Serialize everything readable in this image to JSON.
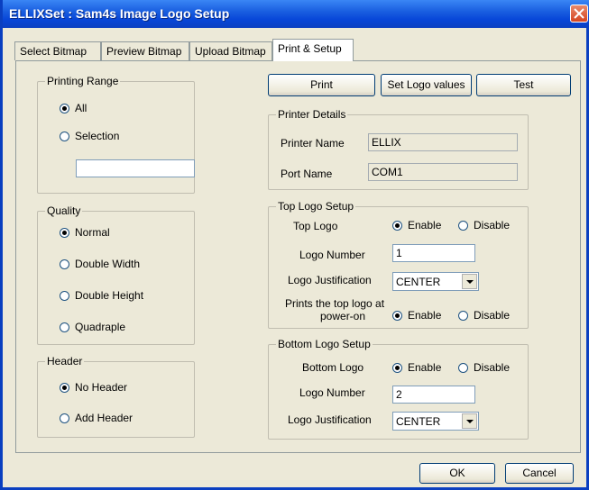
{
  "window": {
    "title": "ELLIXSet : Sam4s Image Logo Setup"
  },
  "tabs": [
    "Select Bitmap",
    "Preview Bitmap",
    "Upload Bitmap",
    "Print & Setup"
  ],
  "printing_range": {
    "legend": "Printing Range",
    "all": "All",
    "selection": "Selection",
    "selected": "All",
    "selection_value": ""
  },
  "quality": {
    "legend": "Quality",
    "options": [
      "Normal",
      "Double Width",
      "Double Height",
      "Quadraple"
    ],
    "selected": "Normal"
  },
  "header": {
    "legend": "Header",
    "options": [
      "No Header",
      "Add Header"
    ],
    "selected": "No Header"
  },
  "buttons": {
    "print": "Print",
    "set_logo": "Set Logo values",
    "test": "Test",
    "ok": "OK",
    "cancel": "Cancel"
  },
  "printer_details": {
    "legend": "Printer Details",
    "printer_name_label": "Printer Name",
    "printer_name": "ELLIX",
    "port_name_label": "Port Name",
    "port_name": "COM1"
  },
  "top_logo": {
    "legend": "Top Logo Setup",
    "top_logo_label": "Top Logo",
    "enable": "Enable",
    "disable": "Disable",
    "logo_number_label": "Logo Number",
    "logo_number": "1",
    "justification_label": "Logo Justification",
    "justification": "CENTER",
    "power_on_label_1": "Prints the top logo at",
    "power_on_label_2": "power-on"
  },
  "bottom_logo": {
    "legend": "Bottom Logo Setup",
    "bottom_logo_label": "Bottom Logo",
    "enable": "Enable",
    "disable": "Disable",
    "logo_number_label": "Logo Number",
    "logo_number": "2",
    "justification_label": "Logo Justification",
    "justification": "CENTER"
  }
}
